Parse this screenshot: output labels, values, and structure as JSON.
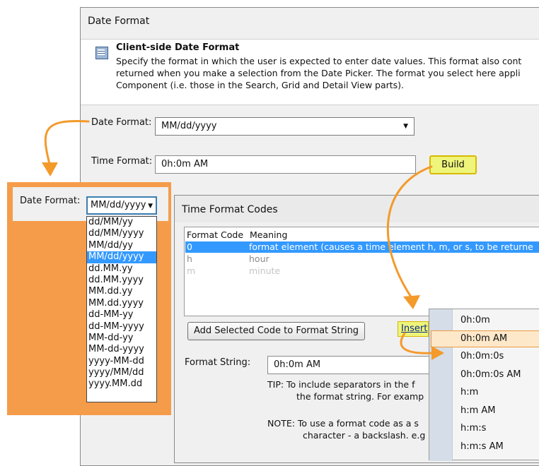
{
  "main_dialog": {
    "title": "Date Format",
    "header_title": "Client-side Date Format",
    "description_lines": [
      "Specify the format in which the user is expected to enter date values. This format also cont",
      "returned when you make a selection from the Date Picker. The format you select here appli",
      "Component (i.e. those in the Search, Grid and Detail View parts)."
    ],
    "date_format_label": "Date Format:",
    "date_format_value": "MM/dd/yyyy",
    "time_format_label": "Time Format:",
    "time_format_value": "0h:0m AM",
    "build_label": "Build"
  },
  "callout": {
    "label": "Date Format:",
    "value": "MM/dd/yyyy",
    "options": [
      "dd/MM/yy",
      "dd/MM/yyyy",
      "MM/dd/yy",
      "MM/dd/yyyy",
      "dd.MM.yy",
      "dd.MM.yyyy",
      "MM.dd.yy",
      "MM.dd.yyyy",
      "dd-MM-yy",
      "dd-MM-yyyy",
      "MM-dd-yy",
      "MM-dd-yyyy",
      "yyyy-MM-dd",
      "yyyy/MM/dd",
      "yyyy.MM.dd"
    ],
    "selected_index": 3
  },
  "time_codes_dialog": {
    "title": "Time Format Codes",
    "columns": [
      "Format Code",
      "Meaning"
    ],
    "rows": [
      {
        "code": "0",
        "meaning": "format element (causes a time element h, m, or s, to be returne"
      },
      {
        "code": "h",
        "meaning": "hour"
      },
      {
        "code": "m",
        "meaning": "minute"
      }
    ],
    "add_button_label": "Add Selected Code to Format String",
    "insert_label": "Insert",
    "format_string_label": "Format String:",
    "format_string_value": "0h:0m AM",
    "tip_lines": [
      "TIP:   To include separators in the f",
      "the format string. For examp"
    ],
    "note_lines": [
      "NOTE:  To use a format code as a s",
      "character - a backslash. e.g"
    ]
  },
  "insert_menu": {
    "items": [
      "0h:0m",
      "0h:0m AM",
      "0h:0m:0s",
      "0h:0m:0s AM",
      "h:m",
      "h:m AM",
      "h:m:s",
      "h:m:s AM"
    ],
    "highlighted_index": 1
  },
  "colors": {
    "callout_orange": "#f59c4a",
    "selection_blue": "#3399ff",
    "highlight_yellow": "#eef57a",
    "arrow_orange": "#f39a2b"
  }
}
